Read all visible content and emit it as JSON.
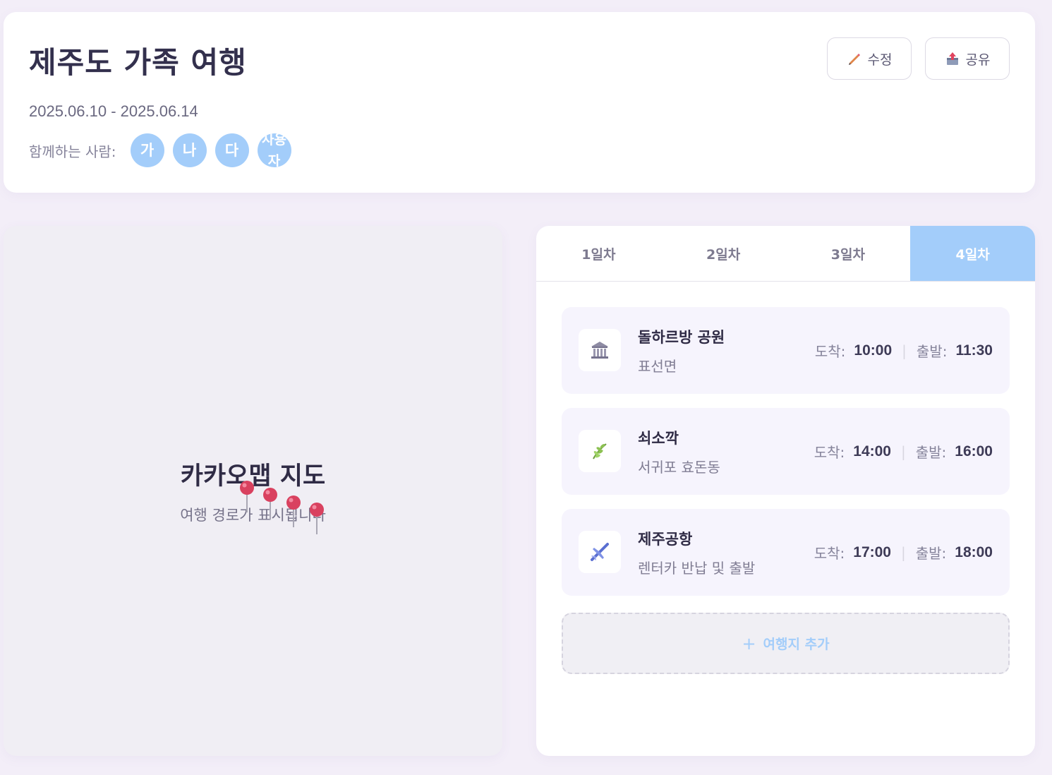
{
  "trip": {
    "title": "제주도 가족 여행",
    "dates": "2025.06.10 - 2025.06.14",
    "companions_label": "함께하는 사람:",
    "companions": [
      "가",
      "나",
      "다",
      "사용자"
    ]
  },
  "actions": {
    "edit_label": "수정",
    "edit_icon": "pencil-icon",
    "share_label": "공유",
    "share_icon": "share-icon"
  },
  "map": {
    "title": "카카오맵 지도",
    "subtitle": "여행 경로가 표시됩니다",
    "pin_icon": "map-pin-icon",
    "pin_color": "#d9415f"
  },
  "itinerary": {
    "tabs": [
      "1일차",
      "2일차",
      "3일차",
      "4일차"
    ],
    "active_tab": "4일차",
    "arrive_label": "도착:",
    "depart_label": "출발:",
    "places": [
      {
        "name": "돌하르방 공원",
        "description": "표선면",
        "icon": "museum-icon",
        "arrive": "10:00",
        "depart": "11:30"
      },
      {
        "name": "쇠소깍",
        "description": "서귀포 효돈동",
        "icon": "herb-icon",
        "arrive": "14:00",
        "depart": "16:00"
      },
      {
        "name": "제주공항",
        "description": "렌터카 반납 및 출발",
        "icon": "airplane-icon",
        "arrive": "17:00",
        "depart": "18:00"
      }
    ],
    "add_label": "여행지 추가"
  },
  "colors": {
    "accent": "#a3cdfa",
    "background": "#f3eef8",
    "card_background": "#f6f4fd"
  }
}
